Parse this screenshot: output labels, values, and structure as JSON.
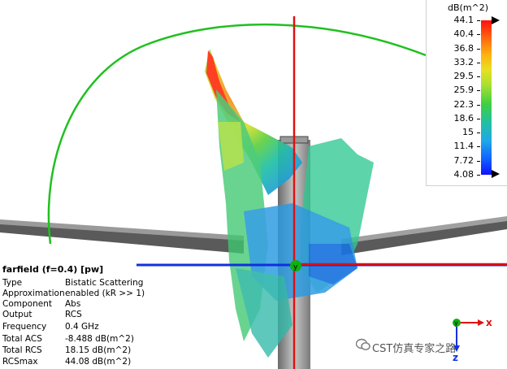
{
  "legend": {
    "unit": "dB(m^2)",
    "ticks": [
      "44.1",
      "40.4",
      "36.8",
      "33.2",
      "29.5",
      "25.9",
      "22.3",
      "18.6",
      "15",
      "11.4",
      "7.72",
      "4.08"
    ]
  },
  "info": {
    "title": "farfield (f=0.4) [pw]",
    "rows": [
      {
        "key": "Type",
        "value": "Bistatic Scattering"
      },
      {
        "key": "Approximation",
        "value": "enabled (kR >> 1)"
      },
      {
        "key": "Component",
        "value": "Abs"
      },
      {
        "key": "Output",
        "value": "RCS"
      },
      {
        "key": "Frequency",
        "value": "0.4 GHz"
      },
      {
        "key": "Total ACS",
        "value": "-8.488 dB(m^2)"
      },
      {
        "key": "Total RCS",
        "value": "18.15 dB(m^2)"
      },
      {
        "key": "RCSmax",
        "value": "44.08 dB(m^2)"
      }
    ]
  },
  "axes": {
    "x": "x",
    "y": "y",
    "z": "z"
  },
  "origin_label": "y",
  "watermark": "CST仿真专家之路",
  "colors": {
    "x_axis": "#e01010",
    "y_axis": "#10b010",
    "z_axis": "#1030e0",
    "arc": "#20c020"
  }
}
